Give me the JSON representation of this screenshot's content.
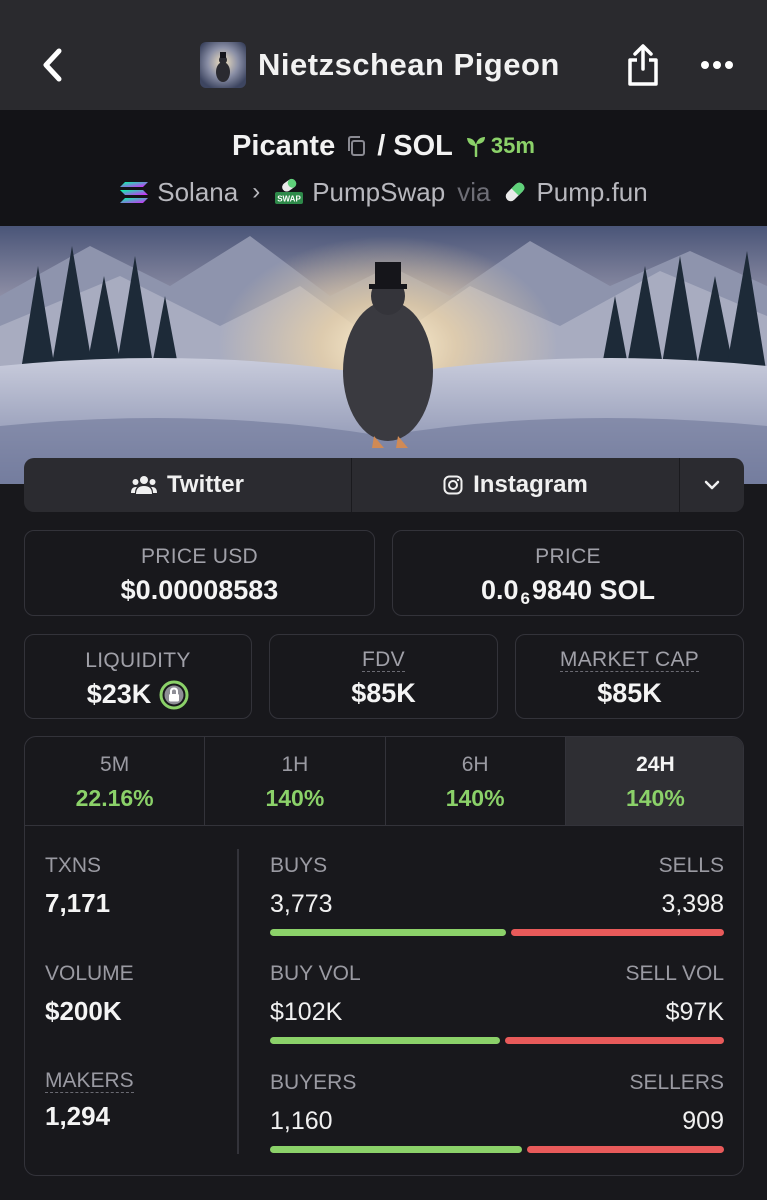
{
  "topbar": {
    "title": "Nietzschean Pigeon",
    "back_icon": "chevron-left-icon",
    "share_icon": "share-icon",
    "more_icon": "more-horizontal-icon"
  },
  "pair": {
    "base": "Picante",
    "separator": "/",
    "quote": "SOL",
    "age": "35m",
    "chain": "Solana",
    "dex": "PumpSwap",
    "via": "via",
    "launchpad": "Pump.fun"
  },
  "socials": {
    "twitter": "Twitter",
    "instagram": "Instagram"
  },
  "stats": {
    "price_usd_label": "PRICE USD",
    "price_usd": "$0.00008583",
    "price_label": "PRICE",
    "price_sol_prefix": "0.0",
    "price_sol_zeros": "6",
    "price_sol_suffix": "9840 SOL",
    "liquidity_label": "LIQUIDITY",
    "liquidity": "$23K",
    "fdv_label": "FDV",
    "fdv": "$85K",
    "mcap_label": "MARKET CAP",
    "mcap": "$85K"
  },
  "timeframes": [
    {
      "label": "5M",
      "change": "22.16%"
    },
    {
      "label": "1H",
      "change": "140%"
    },
    {
      "label": "6H",
      "change": "140%"
    },
    {
      "label": "24H",
      "change": "140%"
    }
  ],
  "active_timeframe": "24H",
  "metrics": {
    "txns_label": "TXNS",
    "txns": "7,171",
    "volume_label": "VOLUME",
    "volume": "$200K",
    "makers_label": "MAKERS",
    "makers": "1,294",
    "buys_label": "BUYS",
    "buys": "3,773",
    "sells_label": "SELLS",
    "sells": "3,398",
    "buy_vol_label": "BUY VOL",
    "buy_vol": "$102K",
    "sell_vol_label": "SELL VOL",
    "sell_vol": "$97K",
    "buyers_label": "BUYERS",
    "buyers": "1,160",
    "sellers_label": "SELLERS",
    "sellers": "909"
  },
  "ratios": {
    "txns_buy_fraction": 0.526,
    "volume_buy_fraction": 0.513,
    "makers_buy_fraction": 0.561
  },
  "colors": {
    "positive": "#8bd169",
    "negative": "#e85a5a",
    "background": "#18181c"
  }
}
